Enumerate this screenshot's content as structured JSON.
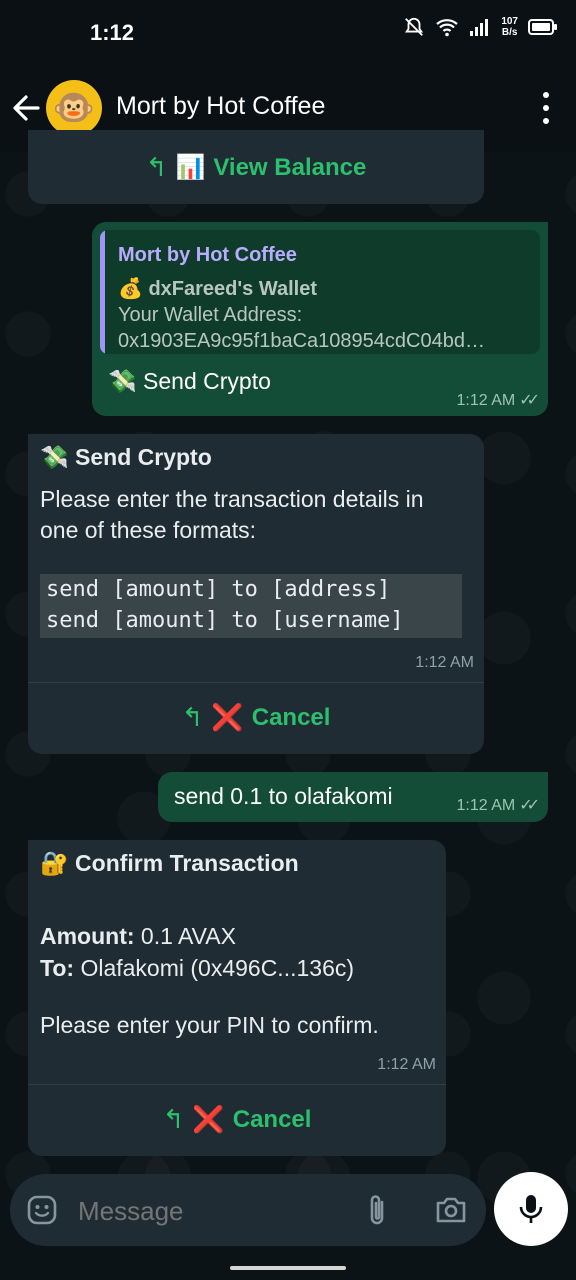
{
  "status_bar": {
    "time": "1:12",
    "net_speed": "107",
    "net_unit": "B/s"
  },
  "header": {
    "title": "Mort by Hot Coffee",
    "avatar_emoji": "🐵"
  },
  "messages": {
    "view_balance": {
      "reply_arrow": "↰",
      "emoji": "📊",
      "label": "View Balance"
    },
    "wallet_reply": {
      "quote_title": "Mort by Hot Coffee",
      "quote_line1": "💰 dxFareed's Wallet",
      "quote_line2": "Your Wallet Address:",
      "quote_line3": "0x1903EA9c95f1baCa108954cdC04bd…",
      "emoji": "💸",
      "text": "Send Crypto",
      "time": "1:12 AM"
    },
    "send_crypto": {
      "emoji": "💸",
      "title": "Send Crypto",
      "line1": "Please enter the transaction details in",
      "line2": "one of these formats:",
      "code1": "send [amount] to [address]",
      "code2": "send [amount] to [username]",
      "time": "1:12 AM",
      "button": {
        "reply_arrow": "↰",
        "emoji": "❌",
        "label": "Cancel"
      }
    },
    "user_send": {
      "text": "send 0.1 to olafakomi",
      "time": "1:12 AM"
    },
    "confirm": {
      "emoji": "🔐",
      "title": "Confirm Transaction",
      "amount_label": "Amount:",
      "amount_value": "0.1 AVAX",
      "to_label": "To:",
      "to_value": "Olafakomi (0x496C...136c)",
      "instruction": "Please enter your PIN to confirm.",
      "time": "1:12 AM",
      "button": {
        "reply_arrow": "↰",
        "emoji": "❌",
        "label": "Cancel"
      }
    }
  },
  "input": {
    "placeholder": "Message"
  },
  "colors": {
    "outgoing": "#134d37",
    "incoming": "#1f2c33",
    "accent": "#2cbf6e",
    "quote_name": "#b8acff"
  }
}
